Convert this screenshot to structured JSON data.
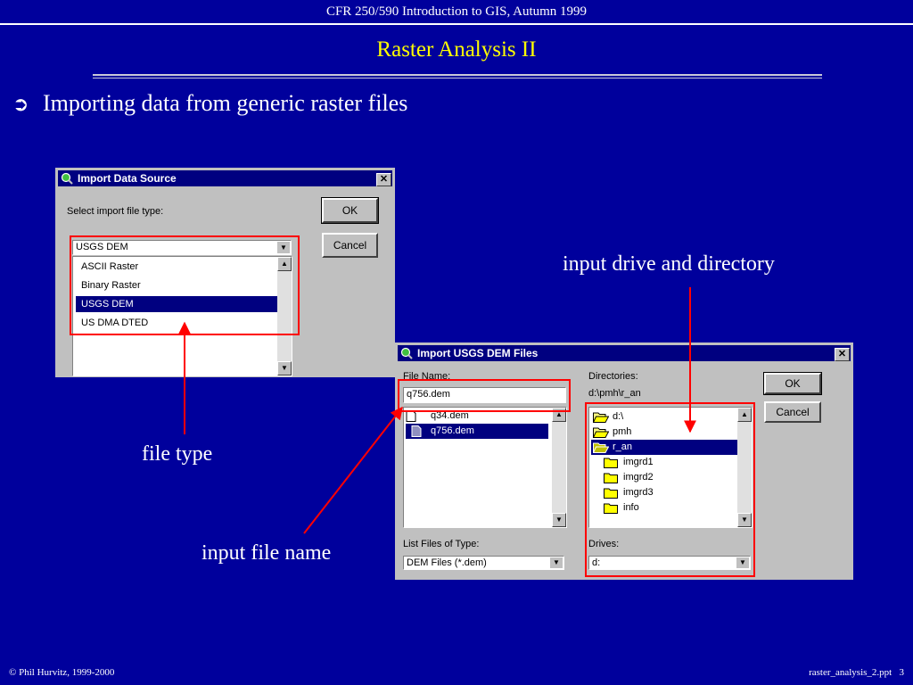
{
  "header": "CFR 250/590 Introduction to GIS, Autumn 1999",
  "title": "Raster Analysis II",
  "bullet": {
    "marker": "➲",
    "text": "Importing data from generic raster files"
  },
  "dialog1": {
    "title": "Import Data Source",
    "close": "✕",
    "prompt": "Select import file type:",
    "ok": "OK",
    "cancel": "Cancel",
    "selected": "USGS DEM",
    "options": [
      "ASCII Raster",
      "Binary Raster",
      "USGS DEM",
      "US DMA DTED"
    ]
  },
  "dialog2": {
    "title": "Import USGS DEM Files",
    "close": "✕",
    "file_name_label": "File Name:",
    "file_name_value": "q756.dem",
    "files": [
      "q34.dem",
      "q756.dem"
    ],
    "directories_label": "Directories:",
    "current_dir": "d:\\pmh\\r_an",
    "dirs": [
      "d:\\",
      "pmh",
      "r_an",
      "imgrd1",
      "imgrd2",
      "imgrd3",
      "info"
    ],
    "ok": "OK",
    "cancel": "Cancel",
    "types_label": "List Files of Type:",
    "types_value": "DEM Files (*.dem)",
    "drives_label": "Drives:",
    "drives_value": "d:"
  },
  "callouts": {
    "dir": "input drive and directory",
    "filetype": "file type",
    "filename": "input file name"
  },
  "footer": {
    "left": "© Phil Hurvitz, 1999-2000",
    "right": "raster_analysis_2.ppt   3"
  },
  "colors": {
    "background": "#00009c",
    "title": "#ffff00",
    "highlight": "#000080",
    "annotation": "#ff0000"
  }
}
